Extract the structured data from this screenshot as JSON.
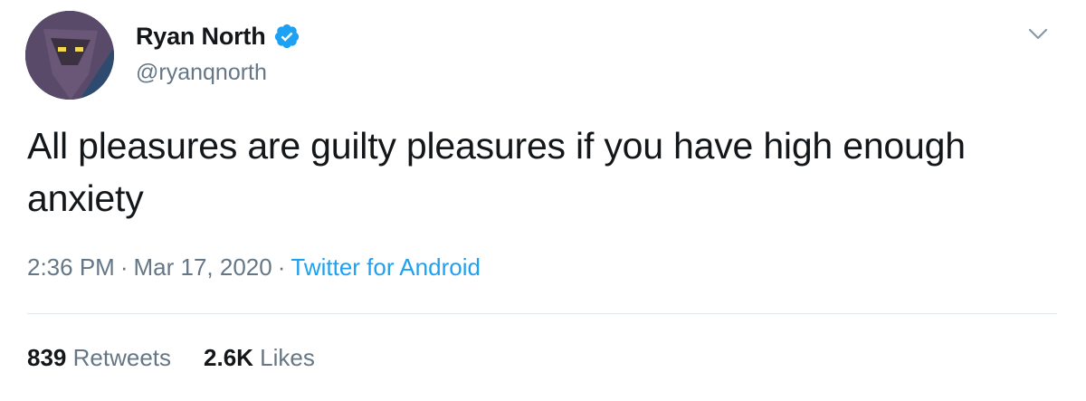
{
  "author": {
    "display_name": "Ryan North",
    "handle": "@ryanqnorth",
    "verified": true
  },
  "tweet": {
    "text": "All pleasures are guilty pleasures if you have high enough anxiety",
    "time": "2:36 PM",
    "date": "Mar 17, 2020",
    "separator": "·",
    "source": "Twitter for Android"
  },
  "stats": {
    "retweets_count": "839",
    "retweets_label": "Retweets",
    "likes_count": "2.6K",
    "likes_label": "Likes"
  },
  "icons": {
    "verified": "verified-badge-icon",
    "menu": "chevron-down-icon"
  },
  "colors": {
    "accent": "#1da1f2",
    "text": "#14171a",
    "secondary": "#657786",
    "divider": "#e1e8ed"
  }
}
